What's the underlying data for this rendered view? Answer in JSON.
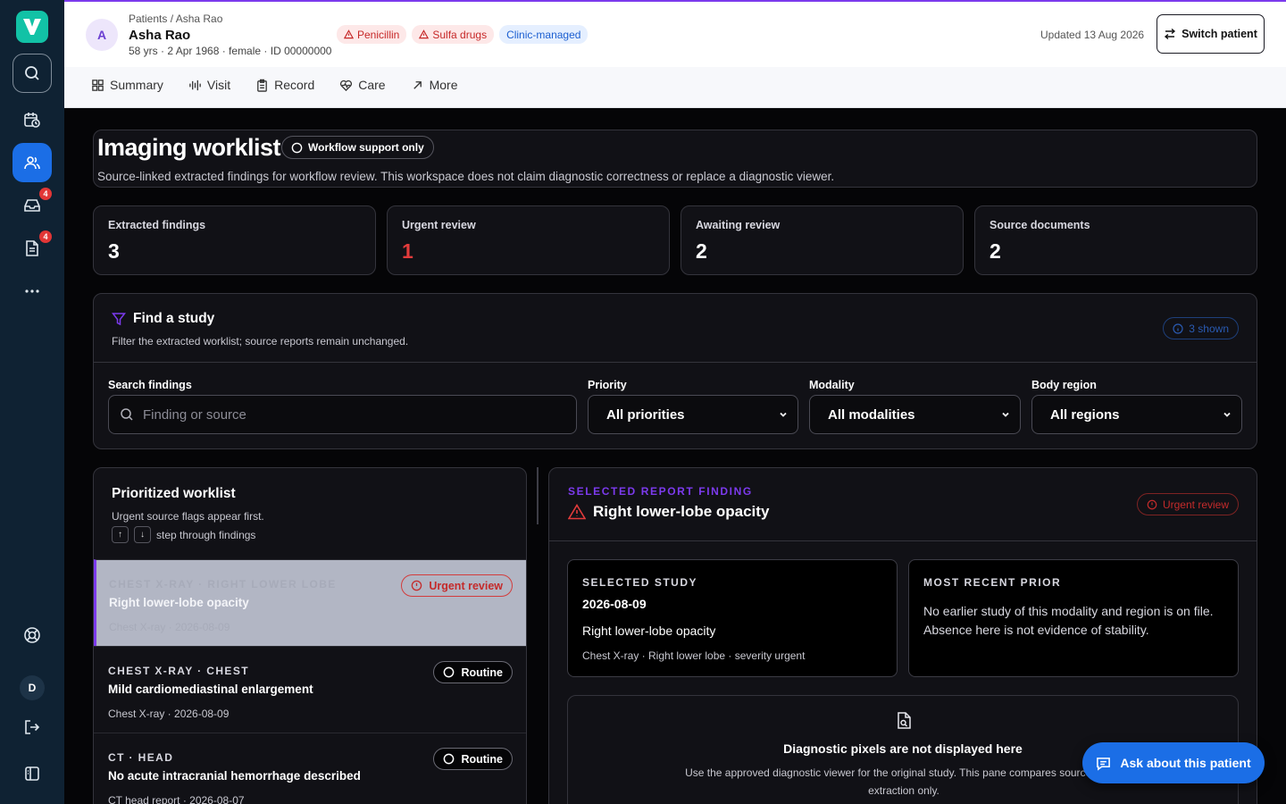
{
  "rail": {
    "badges": {
      "inbox": "4",
      "documents": "4"
    },
    "user_initial": "D"
  },
  "header": {
    "avatar_initial": "A",
    "breadcrumb": "Patients / Asha Rao",
    "patient_name": "Asha Rao",
    "patient_meta": "58 yrs · 2 Apr 1968 · female · ID 00000000",
    "chips": [
      "Penicillin",
      "Sulfa drugs",
      "Clinic-managed"
    ],
    "updated": "Updated 13 Aug 2026",
    "switch_label": "Switch patient"
  },
  "nav": [
    "Summary",
    "Visit",
    "Record",
    "Care",
    "More"
  ],
  "page": {
    "title": "Imaging worklist",
    "badge": "Workflow support only",
    "subtitle": "Source-linked extracted findings for workflow review. This workspace does not claim diagnostic correctness or replace a diagnostic viewer."
  },
  "stats": [
    {
      "label": "Extracted findings",
      "value": "3"
    },
    {
      "label": "Urgent review",
      "value": "1"
    },
    {
      "label": "Awaiting review",
      "value": "2"
    },
    {
      "label": "Source documents",
      "value": "2"
    }
  ],
  "filter": {
    "title": "Find a study",
    "subtitle": "Filter the extracted worklist; source reports remain unchanged.",
    "shown": "3 shown",
    "search_label": "Search findings",
    "search_placeholder": "Finding or source",
    "priority_label": "Priority",
    "priority_value": "All priorities",
    "modality_label": "Modality",
    "modality_value": "All modalities",
    "region_label": "Body region",
    "region_value": "All regions"
  },
  "worklist": {
    "title": "Prioritized worklist",
    "subtitle": "Urgent source flags appear first.",
    "hint": "step through findings",
    "rows": [
      {
        "category": "CHEST X-RAY · RIGHT LOWER LOBE",
        "title": "Right lower-lobe opacity",
        "sub": "Chest X-ray · 2026-08-09",
        "status": "Urgent review"
      },
      {
        "category": "CHEST X-RAY · CHEST",
        "title": "Mild cardiomediastinal enlargement",
        "sub": "Chest X-ray · 2026-08-09",
        "status": "Routine"
      },
      {
        "category": "CT · HEAD",
        "title": "No acute intracranial hemorrhage described",
        "sub": "CT head report · 2026-08-07",
        "status": "Routine"
      }
    ]
  },
  "detail": {
    "kicker": "SELECTED REPORT FINDING",
    "title": "Right lower-lobe opacity",
    "status": "Urgent review",
    "study_label": "SELECTED STUDY",
    "study_date": "2026-08-09",
    "study_name": "Right lower-lobe opacity",
    "study_meta": "Chest X-ray · Right lower lobe · severity urgent",
    "prior_label": "MOST RECENT PRIOR",
    "prior_note": "No earlier study of this modality and region is on file. Absence here is not evidence of stability.",
    "pixels_title": "Diagnostic pixels are not displayed here",
    "pixels_desc": "Use the approved diagnostic viewer for the original study. This pane compares source report extraction only."
  },
  "ask_label": "Ask about this patient"
}
